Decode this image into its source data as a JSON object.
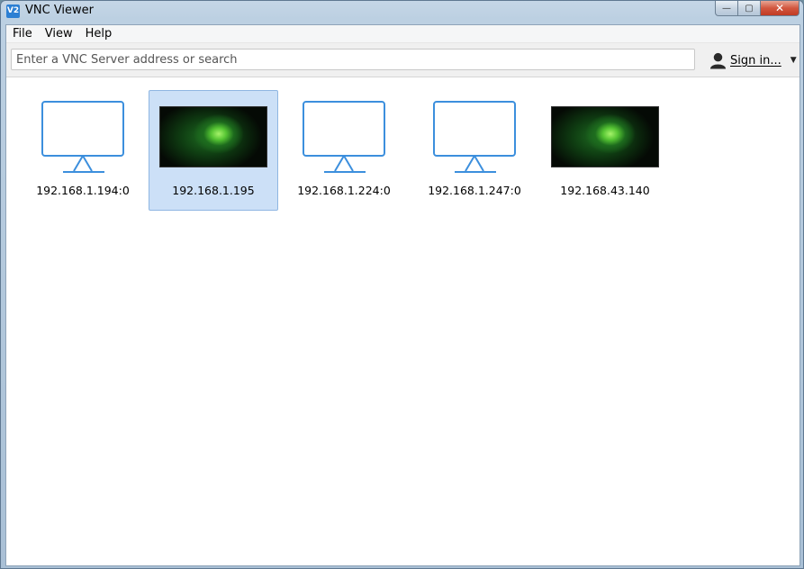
{
  "window": {
    "title": "VNC Viewer",
    "app_icon_text": "V2"
  },
  "window_controls": {
    "minimize": "—",
    "maximize": "▢",
    "close": "✕"
  },
  "menu": {
    "items": [
      {
        "label": "File"
      },
      {
        "label": "View"
      },
      {
        "label": "Help"
      }
    ]
  },
  "toolbar": {
    "search_placeholder": "Enter a VNC Server address or search",
    "signin_label": "Sign in...",
    "signin_caret": "▼"
  },
  "connections": [
    {
      "label": "192.168.1.194:0",
      "thumbnail": "monitor-icon",
      "selected": false
    },
    {
      "label": "192.168.1.195",
      "thumbnail": "screenshot",
      "selected": true
    },
    {
      "label": "192.168.1.224:0",
      "thumbnail": "monitor-icon",
      "selected": false
    },
    {
      "label": "192.168.1.247:0",
      "thumbnail": "monitor-icon",
      "selected": false
    },
    {
      "label": "192.168.43.140",
      "thumbnail": "screenshot",
      "selected": false
    }
  ],
  "colors": {
    "accent": "#3c8fdd",
    "selection": "#cce0f7"
  }
}
